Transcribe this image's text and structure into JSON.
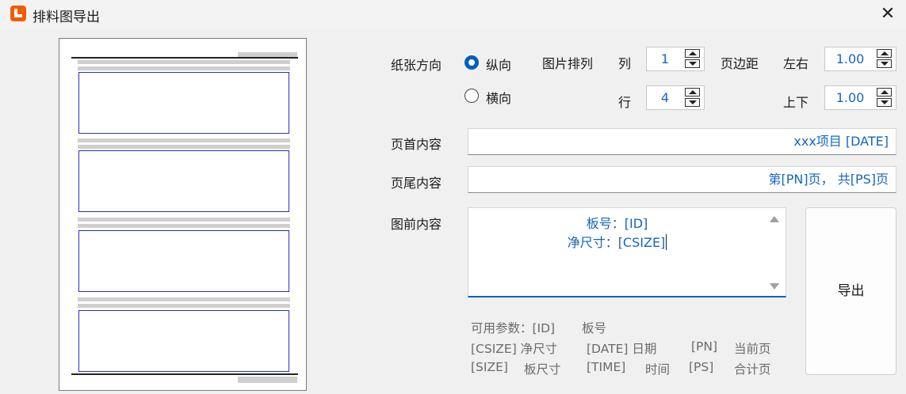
{
  "window": {
    "title": "排料图导出",
    "close_glyph": "✕",
    "icon": "app-logo-icon",
    "accent": "#f25c05"
  },
  "orientation": {
    "label": "纸张方向",
    "options": [
      {
        "label": "纵向",
        "selected": true
      },
      {
        "label": "横向",
        "selected": false
      }
    ]
  },
  "layout": {
    "label": "图片排列",
    "columns": {
      "label": "列",
      "value": "1"
    },
    "rows": {
      "label": "行",
      "value": "4"
    }
  },
  "margins": {
    "label": "页边距",
    "lr": {
      "label": "左右",
      "value": "1.00"
    },
    "tb": {
      "label": "上下",
      "value": "1.00"
    }
  },
  "header": {
    "label": "页首内容",
    "value": "xxx项目  [DATE]"
  },
  "footer": {
    "label": "页尾内容",
    "value": "第[PN]页， 共[PS]页"
  },
  "before_image": {
    "label": "图前内容",
    "line1": "板号：[ID]",
    "line2": "净尺寸：[CSIZE]"
  },
  "export_button": {
    "label": "导出"
  },
  "help": {
    "row1": [
      "可用参数：[ID]",
      "板号"
    ],
    "row2": [
      "[CSIZE] 净尺寸",
      "[DATE] 日期",
      "[PN]",
      "当前页"
    ],
    "row3": [
      "[SIZE]",
      "板尺寸",
      "[TIME]",
      "时间",
      "[PS]",
      "合计页"
    ]
  }
}
